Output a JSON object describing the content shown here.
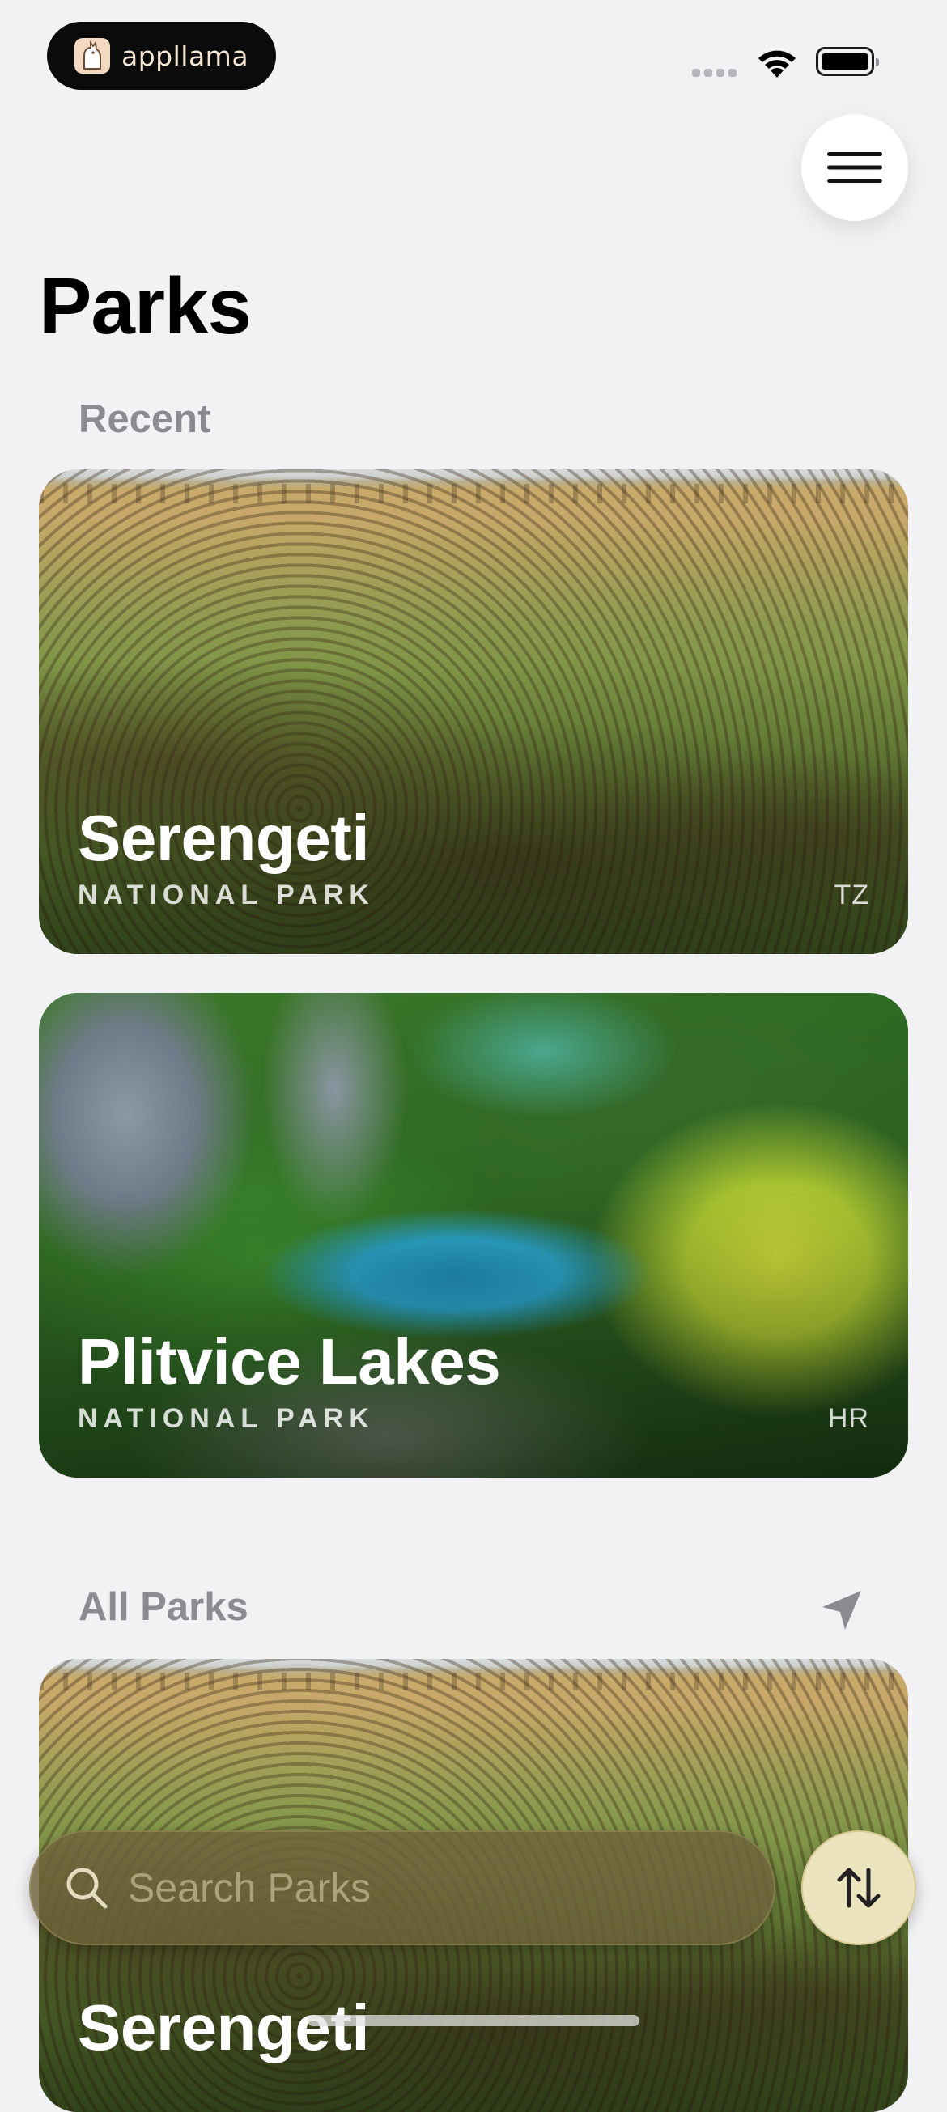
{
  "status_bar": {
    "app_name": "appllama"
  },
  "page": {
    "title": "Parks"
  },
  "sections": {
    "recent_label": "Recent",
    "all_parks_label": "All Parks"
  },
  "recent_parks": [
    {
      "name": "Serengeti",
      "type": "NATIONAL PARK",
      "country": "TZ"
    },
    {
      "name": "Plitvice Lakes",
      "type": "NATIONAL PARK",
      "country": "HR"
    }
  ],
  "all_parks": [
    {
      "name": "Serengeti"
    }
  ],
  "search": {
    "placeholder": "Search Parks",
    "value": ""
  },
  "icons": {
    "menu": "hamburger-menu-icon",
    "location": "location-arrow-icon",
    "search": "magnifier-icon",
    "sort": "up-down-arrows-icon"
  },
  "colors": {
    "background": "#f2f2f4",
    "section_label": "#8b8b90",
    "search_bar": "#6e623c",
    "sort_button": "#ece3bf"
  }
}
